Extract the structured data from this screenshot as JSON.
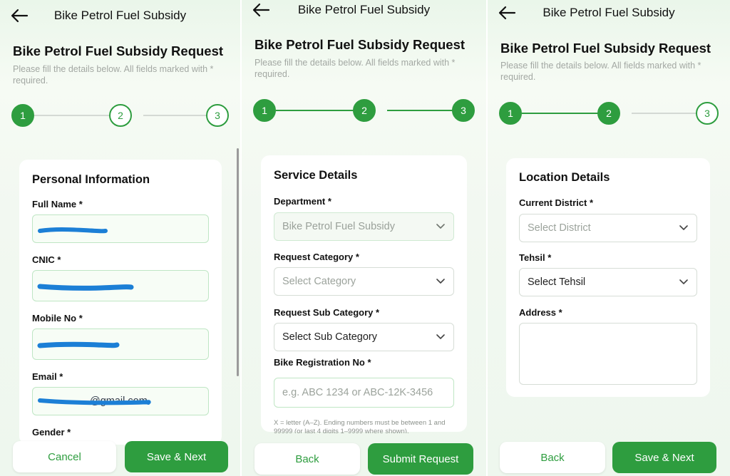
{
  "screens": [
    {
      "topbar_title": "Bike Petrol Fuel Subsidy",
      "heading": "Bike Petrol Fuel Subsidy Request",
      "subtext": "Please fill the details below. All fields marked with * required.",
      "steps": [
        "1",
        "2",
        "3"
      ],
      "active_steps": 1,
      "section_title": "Personal Information",
      "fields": [
        {
          "label": "Full Name *",
          "value": ""
        },
        {
          "label": "CNIC *",
          "value": ""
        },
        {
          "label": "Mobile No *",
          "value": ""
        },
        {
          "label": "Email *",
          "value": "@gmail.com"
        },
        {
          "label": "Gender *",
          "value": ""
        }
      ],
      "buttons": {
        "secondary": "Cancel",
        "primary": "Save & Next"
      }
    },
    {
      "topbar_title": "Bike Petrol Fuel Subsidy",
      "heading": "Bike Petrol Fuel Subsidy Request",
      "subtext": "Please fill the details below. All fields marked with * required.",
      "steps": [
        "1",
        "2",
        "3"
      ],
      "active_steps": 3,
      "section_title": "Service Details",
      "fields": [
        {
          "label": "Department *",
          "value": "Bike Petrol Fuel Subsidy"
        },
        {
          "label": "Request Category *",
          "placeholder": "Select Category"
        },
        {
          "label": "Request Sub Category *",
          "value": "Select Sub Category"
        },
        {
          "label": "Bike Registration No *",
          "placeholder": "e.g. ABC 1234 or ABC-12K-3456"
        }
      ],
      "hint": "X = letter (A–Z). Ending numbers must be between 1 and 99999 (or last 4 digits 1–9999 where shown).",
      "buttons": {
        "secondary": "Back",
        "primary": "Submit Request"
      }
    },
    {
      "topbar_title": "Bike Petrol Fuel Subsidy",
      "heading": "Bike Petrol Fuel Subsidy Request",
      "subtext": "Please fill the details below. All fields marked with * required.",
      "steps": [
        "1",
        "2",
        "3"
      ],
      "active_steps": 2,
      "section_title": "Location Details",
      "fields": [
        {
          "label": "Current District *",
          "placeholder": "Select District"
        },
        {
          "label": "Tehsil *",
          "value": "Select Tehsil"
        },
        {
          "label": "Address *",
          "value": ""
        }
      ],
      "buttons": {
        "secondary": "Back",
        "primary": "Save & Next"
      }
    }
  ],
  "colors": {
    "accent": "#2e9d3f",
    "field_border": "#bfe6c4",
    "muted_text": "#a3a8a3",
    "redaction": "#1c7fd6"
  }
}
